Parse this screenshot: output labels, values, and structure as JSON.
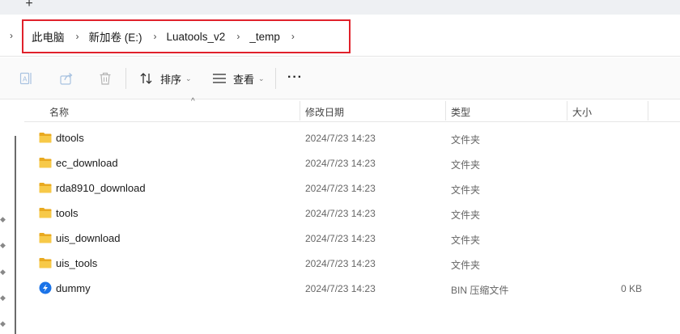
{
  "tabstrip": {
    "new_tab_label": "+"
  },
  "address": {
    "expand_glyph": "›",
    "breadcrumbs": [
      {
        "label": "此电脑"
      },
      {
        "label": "新加卷 (E:)"
      },
      {
        "label": "Luatools_v2"
      },
      {
        "label": "_temp"
      }
    ],
    "separator": "›",
    "highlight_color": "#e0212b"
  },
  "toolbar": {
    "rename_icon": "rename-icon",
    "share_icon": "share-icon",
    "delete_icon": "trash-icon",
    "sort_label": "排序",
    "view_label": "查看",
    "caret": "⌄",
    "more_label": "···"
  },
  "list": {
    "sort_indicator": "^",
    "columns": {
      "name": "名称",
      "date": "修改日期",
      "type": "类型",
      "size": "大小"
    },
    "rows": [
      {
        "name": "dtools",
        "date": "2024/7/23 14:23",
        "type": "文件夹",
        "size": "",
        "icon": "folder-icon"
      },
      {
        "name": "ec_download",
        "date": "2024/7/23 14:23",
        "type": "文件夹",
        "size": "",
        "icon": "folder-icon"
      },
      {
        "name": "rda8910_download",
        "date": "2024/7/23 14:23",
        "type": "文件夹",
        "size": "",
        "icon": "folder-icon"
      },
      {
        "name": "tools",
        "date": "2024/7/23 14:23",
        "type": "文件夹",
        "size": "",
        "icon": "folder-icon"
      },
      {
        "name": "uis_download",
        "date": "2024/7/23 14:23",
        "type": "文件夹",
        "size": "",
        "icon": "folder-icon"
      },
      {
        "name": "uis_tools",
        "date": "2024/7/23 14:23",
        "type": "文件夹",
        "size": "",
        "icon": "folder-icon"
      },
      {
        "name": "dummy",
        "date": "2024/7/23 14:23",
        "type": "BIN 压缩文件",
        "size": "0 KB",
        "icon": "archive-file-icon"
      }
    ]
  },
  "colors": {
    "folder": "#f7c948",
    "folder_dark": "#e9a91f",
    "archive": "#1a73e8"
  }
}
